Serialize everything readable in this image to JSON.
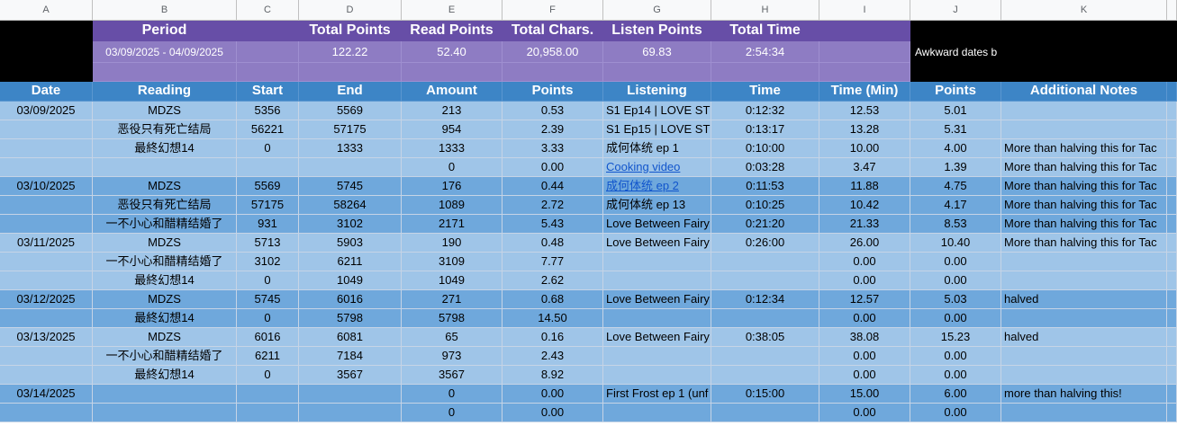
{
  "column_letters": [
    "A",
    "B",
    "C",
    "D",
    "E",
    "F",
    "G",
    "H",
    "I",
    "J",
    "K"
  ],
  "summary": {
    "headers": [
      "Period",
      "",
      "Total Points",
      "Read Points",
      "Total Chars.",
      "Listen Points",
      "Total Time",
      ""
    ],
    "values": [
      "03/09/2025 - 04/09/2025",
      "",
      "122.22",
      "52.40",
      "20,958.00",
      "69.83",
      "2:54:34",
      ""
    ],
    "side_note": "Awkward dates b"
  },
  "table_headers": [
    "Date",
    "Reading",
    "Start",
    "End",
    "Amount",
    "Points",
    "Listening",
    "Time",
    "Time (Min)",
    "Points",
    "Additional Notes"
  ],
  "rows": [
    {
      "date": "03/09/2025",
      "reading": "MDZS",
      "start": "5356",
      "end": "5569",
      "amount": "213",
      "points": "0.53",
      "listening": "S1 Ep14 | LOVE ST",
      "time": "0:12:32",
      "time_min": "12.53",
      "lpoints": "5.01",
      "notes": "",
      "link": false,
      "shade": "light"
    },
    {
      "date": "",
      "reading": "恶役只有死亡结局",
      "start": "56221",
      "end": "57175",
      "amount": "954",
      "points": "2.39",
      "listening": "S1 Ep15 | LOVE ST",
      "time": "0:13:17",
      "time_min": "13.28",
      "lpoints": "5.31",
      "notes": "",
      "link": false,
      "shade": "light"
    },
    {
      "date": "",
      "reading": "最終幻想14",
      "start": "0",
      "end": "1333",
      "amount": "1333",
      "points": "3.33",
      "listening": "成何体统 ep 1",
      "time": "0:10:00",
      "time_min": "10.00",
      "lpoints": "4.00",
      "notes": "More than halving this for Tac",
      "link": false,
      "shade": "light"
    },
    {
      "date": "",
      "reading": "",
      "start": "",
      "end": "",
      "amount": "0",
      "points": "0.00",
      "listening": "Cooking video",
      "time": "0:03:28",
      "time_min": "3.47",
      "lpoints": "1.39",
      "notes": "More than halving this for Tac",
      "link": true,
      "shade": "light"
    },
    {
      "date": "03/10/2025",
      "reading": "MDZS",
      "start": "5569",
      "end": "5745",
      "amount": "176",
      "points": "0.44",
      "listening": "成何体统 ep 2",
      "time": "0:11:53",
      "time_min": "11.88",
      "lpoints": "4.75",
      "notes": "More than halving this for Tac",
      "link": true,
      "shade": "mid"
    },
    {
      "date": "",
      "reading": "恶役只有死亡结局",
      "start": "57175",
      "end": "58264",
      "amount": "1089",
      "points": "2.72",
      "listening": "成何体统 ep 13",
      "time": "0:10:25",
      "time_min": "10.42",
      "lpoints": "4.17",
      "notes": "More than halving this for Tac",
      "link": false,
      "shade": "mid"
    },
    {
      "date": "",
      "reading": "一不小心和醋精结婚了",
      "start": "931",
      "end": "3102",
      "amount": "2171",
      "points": "5.43",
      "listening": "Love Between Fairy",
      "time": "0:21:20",
      "time_min": "21.33",
      "lpoints": "8.53",
      "notes": "More than halving this for Tac",
      "link": false,
      "shade": "mid"
    },
    {
      "date": "03/11/2025",
      "reading": "MDZS",
      "start": "5713",
      "end": "5903",
      "amount": "190",
      "points": "0.48",
      "listening": "Love Between Fairy",
      "time": "0:26:00",
      "time_min": "26.00",
      "lpoints": "10.40",
      "notes": "More than halving this for Tac",
      "link": false,
      "shade": "light"
    },
    {
      "date": "",
      "reading": "一不小心和醋精结婚了",
      "start": "3102",
      "end": "6211",
      "amount": "3109",
      "points": "7.77",
      "listening": "",
      "time": "",
      "time_min": "0.00",
      "lpoints": "0.00",
      "notes": "",
      "link": false,
      "shade": "light"
    },
    {
      "date": "",
      "reading": "最終幻想14",
      "start": "0",
      "end": "1049",
      "amount": "1049",
      "points": "2.62",
      "listening": "",
      "time": "",
      "time_min": "0.00",
      "lpoints": "0.00",
      "notes": "",
      "link": false,
      "shade": "light"
    },
    {
      "date": "03/12/2025",
      "reading": "MDZS",
      "start": "5745",
      "end": "6016",
      "amount": "271",
      "points": "0.68",
      "listening": "Love Between Fairy",
      "time": "0:12:34",
      "time_min": "12.57",
      "lpoints": "5.03",
      "notes": "halved",
      "link": false,
      "shade": "mid"
    },
    {
      "date": "",
      "reading": "最終幻想14",
      "start": "0",
      "end": "5798",
      "amount": "5798",
      "points": "14.50",
      "listening": "",
      "time": "",
      "time_min": "0.00",
      "lpoints": "0.00",
      "notes": "",
      "link": false,
      "shade": "mid"
    },
    {
      "date": "03/13/2025",
      "reading": "MDZS",
      "start": "6016",
      "end": "6081",
      "amount": "65",
      "points": "0.16",
      "listening": "Love Between Fairy",
      "time": "0:38:05",
      "time_min": "38.08",
      "lpoints": "15.23",
      "notes": "halved",
      "link": false,
      "shade": "light"
    },
    {
      "date": "",
      "reading": "一不小心和醋精结婚了",
      "start": "6211",
      "end": "7184",
      "amount": "973",
      "points": "2.43",
      "listening": "",
      "time": "",
      "time_min": "0.00",
      "lpoints": "0.00",
      "notes": "",
      "link": false,
      "shade": "light"
    },
    {
      "date": "",
      "reading": "最終幻想14",
      "start": "0",
      "end": "3567",
      "amount": "3567",
      "points": "8.92",
      "listening": "",
      "time": "",
      "time_min": "0.00",
      "lpoints": "0.00",
      "notes": "",
      "link": false,
      "shade": "light"
    },
    {
      "date": "03/14/2025",
      "reading": "",
      "start": "",
      "end": "",
      "amount": "0",
      "points": "0.00",
      "listening": "First Frost ep 1 (unf",
      "time": "0:15:00",
      "time_min": "15.00",
      "lpoints": "6.00",
      "notes": "more than halving this!",
      "link": false,
      "shade": "mid"
    },
    {
      "date": "",
      "reading": "",
      "start": "",
      "end": "",
      "amount": "0",
      "points": "0.00",
      "listening": "",
      "time": "",
      "time_min": "0.00",
      "lpoints": "0.00",
      "notes": "",
      "link": false,
      "shade": "mid"
    }
  ],
  "colors": {
    "purple_header": "#674ea7",
    "purple_value": "#8e7cc3",
    "blue_header": "#3d85c6",
    "row_light": "#9fc5e8",
    "row_mid": "#6fa8dc",
    "link": "#1155cc"
  }
}
